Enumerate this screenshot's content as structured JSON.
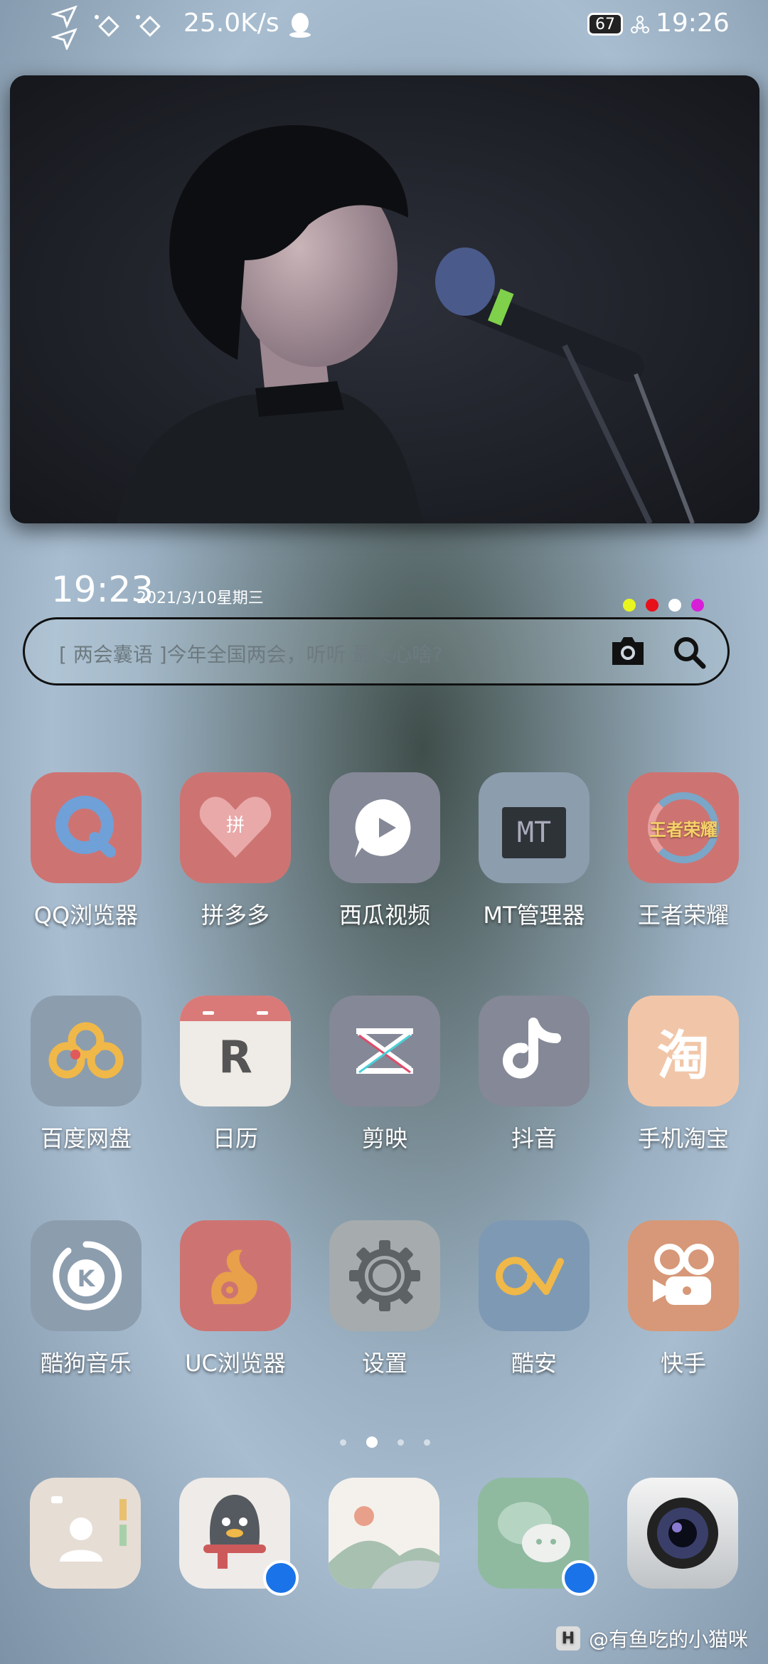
{
  "status_bar": {
    "speed": "25.0K/s",
    "battery": "67",
    "time": "19:26"
  },
  "widget": {
    "clock": "19:23",
    "date": "2021/3/10星期三",
    "dot_colors": [
      "#e8f51f",
      "#e8101a",
      "#ffffff",
      "#d81fd8"
    ]
  },
  "search": {
    "placeholder": "[ 两会囊语 ]今年全国两会，听听 最关心啥?"
  },
  "apps": [
    {
      "label": "QQ浏览器",
      "icon": "qq-browser-icon"
    },
    {
      "label": "拼多多",
      "icon": "pinduoduo-icon"
    },
    {
      "label": "西瓜视频",
      "icon": "xigua-video-icon"
    },
    {
      "label": "MT管理器",
      "icon": "mt-manager-icon"
    },
    {
      "label": "王者荣耀",
      "icon": "honor-of-kings-icon"
    },
    {
      "label": "百度网盘",
      "icon": "baidu-netdisk-icon"
    },
    {
      "label": "日历",
      "icon": "calendar-icon"
    },
    {
      "label": "剪映",
      "icon": "jianying-icon"
    },
    {
      "label": "抖音",
      "icon": "douyin-icon"
    },
    {
      "label": "手机淘宝",
      "icon": "taobao-icon"
    },
    {
      "label": "酷狗音乐",
      "icon": "kugou-music-icon"
    },
    {
      "label": "UC浏览器",
      "icon": "uc-browser-icon"
    },
    {
      "label": "设置",
      "icon": "settings-gear-icon"
    },
    {
      "label": "酷安",
      "icon": "coolapk-icon"
    },
    {
      "label": "快手",
      "icon": "kuaishou-icon"
    }
  ],
  "dock": [
    "contacts-icon",
    "qq-icon",
    "gallery-icon",
    "wechat-icon",
    "camera-icon"
  ],
  "icon_text": {
    "mt": "MT",
    "game": "王者荣耀",
    "pdd": "拼",
    "calendar": "R",
    "taobao": "淘",
    "kugou": "K"
  },
  "watermark": {
    "badge": "H",
    "text": "@有鱼吃的小猫咪"
  }
}
